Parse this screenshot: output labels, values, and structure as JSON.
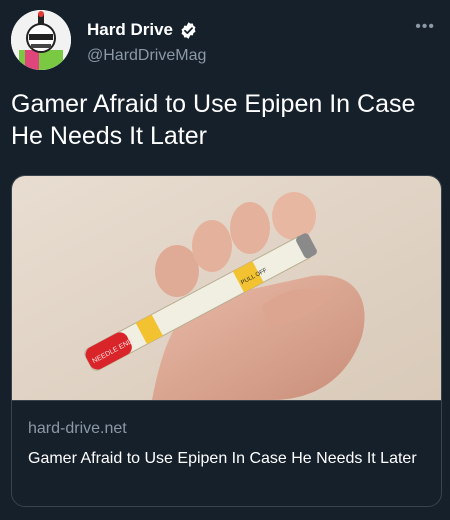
{
  "tweet": {
    "display_name": "Hard Drive",
    "handle": "@HardDriveMag",
    "more_icon": "more-dots-icon",
    "verified_icon": "verified-badge-icon",
    "text": "Gamer Afraid to Use Epipen In Case He Needs It Later"
  },
  "card": {
    "domain": "hard-drive.net",
    "title": "Gamer Afraid to Use Epipen In Case He Needs It Later",
    "image": {
      "pen_label_needle": "NEEDLE END",
      "pen_label_pull": "PULL OFF"
    }
  },
  "colors": {
    "background": "#15202b",
    "secondary_text": "#8b98a5",
    "border": "#38444d",
    "verified": "#ffffff"
  }
}
